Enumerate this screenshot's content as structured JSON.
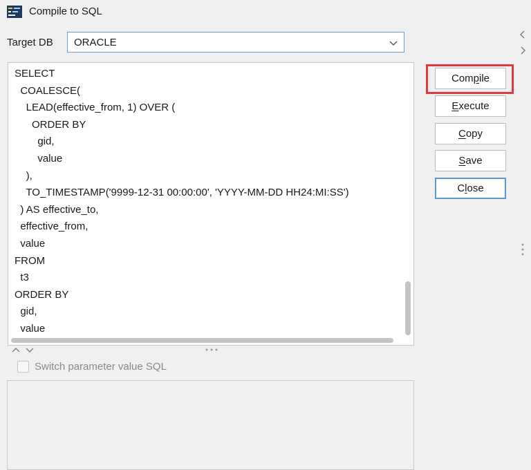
{
  "window": {
    "title": "Compile to SQL"
  },
  "target_db": {
    "label": "Target DB",
    "selected": "ORACLE"
  },
  "sql_editor": {
    "lines": [
      "SELECT",
      "  COALESCE(",
      "    LEAD(effective_from, 1) OVER (",
      "      ORDER BY",
      "        gid,",
      "        value",
      "    ),",
      "    TO_TIMESTAMP('9999-12-31 00:00:00', 'YYYY-MM-DD HH24:MI:SS')",
      "  ) AS effective_to,",
      "  effective_from,",
      "  value",
      "FROM",
      "  t3",
      "ORDER BY",
      "  gid,",
      "  value"
    ]
  },
  "switch_param": {
    "label": "Switch parameter value SQL",
    "checked": false
  },
  "buttons": {
    "compile": {
      "pre": "Com",
      "mnemonic": "p",
      "post": "ile"
    },
    "execute": {
      "pre": "",
      "mnemonic": "E",
      "post": "xecute"
    },
    "copy": {
      "pre": "",
      "mnemonic": "C",
      "post": "opy"
    },
    "save": {
      "pre": "",
      "mnemonic": "S",
      "post": "ave"
    },
    "close": {
      "pre": "C",
      "mnemonic": "l",
      "post": "ose"
    }
  },
  "colors": {
    "highlight": "#e03a3a",
    "focus_border": "#5b98d6",
    "select_border": "#6ea0d0"
  }
}
